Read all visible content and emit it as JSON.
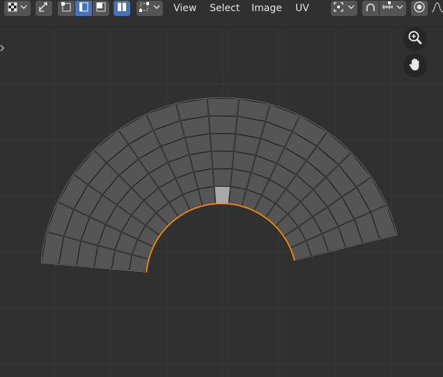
{
  "header": {
    "editor_type_icon": "uv-editor-checker-icon",
    "sync_selection_icon": "sync-selection-arrows-icon",
    "select_modes": [
      "vertex-select-mode-icon",
      "edge-select-mode-icon",
      "face-select-mode-icon"
    ],
    "island_mode_icon": "island-select-icon",
    "sticky_select_icon": "sticky-selection-icon",
    "menus": {
      "view": "View",
      "select": "Select",
      "image": "Image",
      "uv": "UV"
    },
    "pivot_icon": "pivot-point-icon",
    "snap_icon": "snap-magnet-icon",
    "snap_target_icon": "snap-increment-icon",
    "proportional_icon": "proportional-editing-icon",
    "falloff_icon": "falloff-curve-icon"
  },
  "viewport": {
    "zoom_icon": "zoom-in-icon",
    "pan_icon": "hand-pan-icon",
    "sidebar_toggle_icon": "sidebar-arrow-icon"
  },
  "colors": {
    "background": "#303030",
    "grid": "#3a3a3a",
    "face_fill": "#555555",
    "face_selected": "#a8a8a8",
    "edge": "#1e1e1e",
    "edge_outer": "#a6a6a6",
    "seam_selected": "#ff8c00",
    "active_blue": "#4772b3"
  },
  "uv_mesh": {
    "ring_count": 6,
    "segment_count": 16,
    "selected_face": {
      "ring": 0,
      "segment": 8
    }
  }
}
